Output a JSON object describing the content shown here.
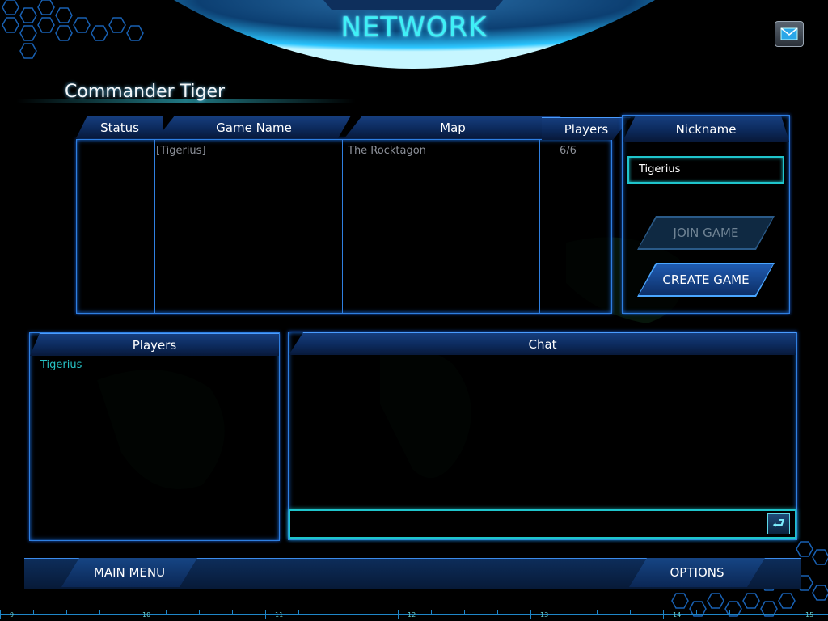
{
  "screen": {
    "title": "NETWORK",
    "commander_name": "Commander Tiger"
  },
  "games_table": {
    "columns": [
      "Status",
      "Game Name",
      "Map",
      "Players"
    ],
    "rows": [
      {
        "status": "",
        "game_name": "[Tigerius]",
        "map": "The Rocktagon",
        "players": "6/6"
      }
    ]
  },
  "nickname_panel": {
    "header": "Nickname",
    "value": "Tigerius",
    "join_label": "JOIN GAME",
    "create_label": "CREATE GAME"
  },
  "players_panel": {
    "header": "Players",
    "items": [
      "Tigerius"
    ]
  },
  "chat_panel": {
    "header": "Chat",
    "input_value": ""
  },
  "bottom_bar": {
    "main_menu_label": "MAIN MENU",
    "options_label": "OPTIONS"
  },
  "ruler": {
    "ticks": [
      "9",
      "10",
      "11",
      "12",
      "13",
      "14",
      "15"
    ]
  },
  "icons": {
    "mail": "mail-icon",
    "enter": "enter-arrow-icon"
  },
  "colors": {
    "accent_cyan": "#3ff0f6",
    "panel_border": "#2f7fe0",
    "input_border": "#1fc5cc"
  }
}
